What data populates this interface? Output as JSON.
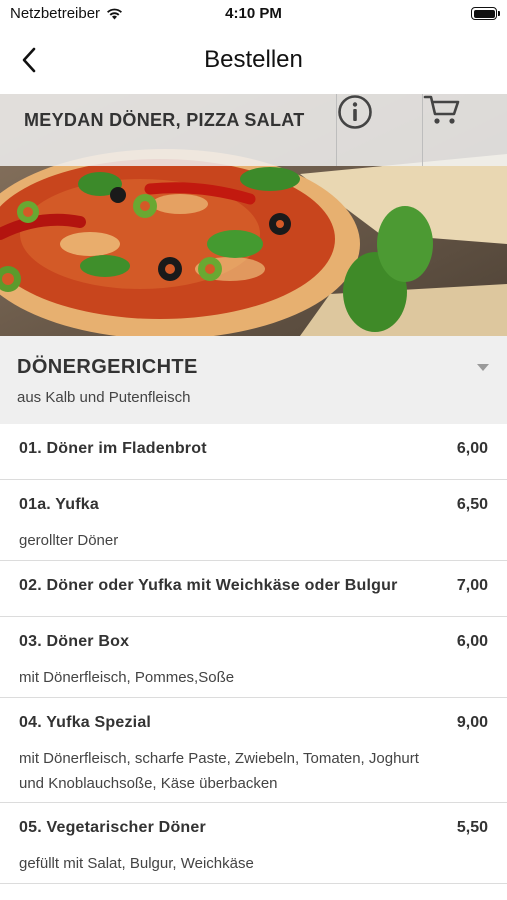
{
  "status_bar": {
    "carrier": "Netzbetreiber",
    "time": "4:10 PM"
  },
  "nav": {
    "title": "Bestellen"
  },
  "hero": {
    "restaurant_name": "MEYDAN DÖNER, PIZZA SALAT"
  },
  "category": {
    "title": "DÖNERGERICHTE",
    "subtitle": "aus Kalb und Putenfleisch"
  },
  "items": [
    {
      "name": "01. Döner im Fladenbrot",
      "price": "6,00",
      "description": ""
    },
    {
      "name": "01a. Yufka",
      "price": "6,50",
      "description": "gerollter Döner"
    },
    {
      "name": "02. Döner oder Yufka mit Weichkäse oder Bulgur",
      "price": "7,00",
      "description": ""
    },
    {
      "name": "03. Döner Box",
      "price": "6,00",
      "description": "mit Dönerfleisch, Pommes,Soße"
    },
    {
      "name": "04. Yufka Spezial",
      "price": "9,00",
      "description": "mit Dönerfleisch, scharfe Paste, Zwiebeln, Tomaten, Joghurt und Knoblauchsoße, Käse überbacken"
    },
    {
      "name": "05. Vegetarischer Döner",
      "price": "5,50",
      "description": "gefüllt mit Salat, Bulgur, Weichkäse"
    }
  ]
}
